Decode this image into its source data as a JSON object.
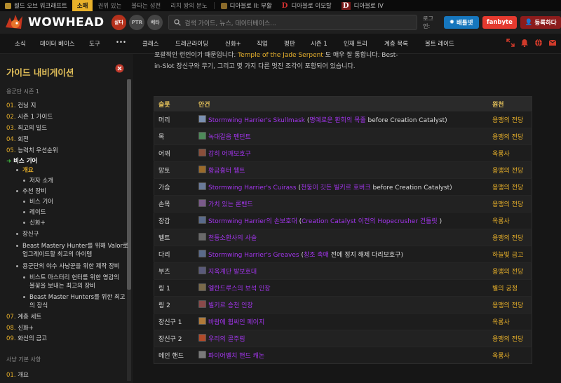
{
  "topbar": {
    "items": [
      {
        "label": "월드 오브 워크래프트",
        "color": "#b38c2d",
        "style": "normal"
      },
      {
        "label": "소매",
        "color": "",
        "style": "active"
      },
      {
        "label": "권위 있는",
        "color": "",
        "style": "dim"
      },
      {
        "label": "불타는 성전",
        "color": "",
        "style": "dim"
      },
      {
        "label": "리치 왕의 분노",
        "color": "",
        "style": "dim"
      }
    ],
    "diablo": [
      "디아블로 II: 부활",
      "디아블로 이모탈",
      "디아블로 IV"
    ]
  },
  "header": {
    "logo_text": "WOWHEAD",
    "pills": [
      "살다",
      "PTR",
      "베타"
    ],
    "search_placeholder": "검색 가이드, 뉴스, 데이터베이스...",
    "login_label": "로그인:",
    "buttons": [
      "배틀넷",
      "fanbyte",
      "등록하다"
    ]
  },
  "nav": {
    "items": [
      "소식",
      "데이터 베이스",
      "도구",
      "•••",
      "클래스",
      "드레곤라이딩",
      "신화+",
      "직업",
      "평판",
      "시즌 1",
      "인재 트리",
      "계층 목록",
      "볼트 레이드"
    ]
  },
  "sidebar": {
    "title": "가이드 내비게이션",
    "section1": "용군단 시즌 1",
    "items": [
      {
        "num": "01.",
        "label": "컨닝 지",
        "type": "num"
      },
      {
        "num": "02.",
        "label": "시즌 1 가이드",
        "type": "num"
      },
      {
        "num": "03.",
        "label": "최고의 빌드",
        "type": "num"
      },
      {
        "num": "04.",
        "label": "회전",
        "type": "num"
      },
      {
        "num": "05.",
        "label": "능력치 우선순위",
        "type": "num"
      },
      {
        "num": "",
        "label": "비스 기어",
        "type": "current"
      },
      {
        "num": "",
        "label": "개요",
        "type": "sub-current"
      },
      {
        "num": "",
        "label": "저자 소개",
        "type": "sub2"
      },
      {
        "num": "",
        "label": "추천 장비",
        "type": "sub"
      },
      {
        "num": "",
        "label": "비스 기어",
        "type": "sub2"
      },
      {
        "num": "",
        "label": "레이드",
        "type": "sub2"
      },
      {
        "num": "",
        "label": "신화+",
        "type": "sub2"
      },
      {
        "num": "",
        "label": "장신구",
        "type": "sub"
      },
      {
        "num": "",
        "label": "Beast Mastery Hunter를 위해 Valor로",
        "type": "sub"
      },
      {
        "num": "",
        "label": "업그레이드할 최고의 아이템",
        "type": "cont"
      },
      {
        "num": "",
        "label": "용군단의 야수 사냥꾼을 위한 제작 장비",
        "type": "sub"
      },
      {
        "num": "",
        "label": "비스트 마스터리 헌터를 위한 영감의",
        "type": "sub2"
      },
      {
        "num": "",
        "label": "불꽃을 보내는 최고의 장비",
        "type": "cont2"
      },
      {
        "num": "",
        "label": "Beast Master Hunters를 위한 최고",
        "type": "sub2"
      },
      {
        "num": "",
        "label": "의 장식",
        "type": "cont2"
      },
      {
        "num": "07.",
        "label": "계층 세트",
        "type": "num"
      },
      {
        "num": "08.",
        "label": "신화+",
        "type": "num"
      },
      {
        "num": "09.",
        "label": "화신의 금고",
        "type": "num"
      }
    ],
    "section2": "사냥 기본 사항",
    "items2": [
      {
        "num": "01.",
        "label": "개요"
      }
    ]
  },
  "content": {
    "intro_line1_a": "포괄적인 런인이기 때문입니다.",
    "intro_line1_link": "Temple of the Jade Serpent",
    "intro_line1_b": "도 매우 잘 통합니다. Best-",
    "intro_line2": "in-Slot 장신구와 무기, 그리고 몇 가지 다른 멋진 조각이 포함되어 있습니다."
  },
  "table": {
    "headers": [
      "슬롯",
      "안건",
      "원천"
    ],
    "rows": [
      {
        "slot": "머리",
        "icon": "#7a8fb0",
        "parts": [
          {
            "t": "Stormwing Harrier's Skullmask",
            "c": "ep"
          },
          {
            "t": " (",
            "c": "item"
          },
          {
            "t": "명예로운 환희의 목줄",
            "c": "ep"
          },
          {
            "t": " before Creation Catalyst)",
            "c": "item"
          }
        ],
        "source": "용맹의 전당"
      },
      {
        "slot": "목",
        "icon": "#4e8a5a",
        "parts": [
          {
            "t": "녹대갈음 펜던트",
            "c": "ep"
          }
        ],
        "source": "용맹의 전당"
      },
      {
        "slot": "어깨",
        "icon": "#8a4e3a",
        "parts": [
          {
            "t": "감히 어깨보호구",
            "c": "ep"
          }
        ],
        "source": "옥룡사"
      },
      {
        "slot": "망토",
        "icon": "#9a6a2a",
        "parts": [
          {
            "t": "황금흉터 웹트",
            "c": "ep"
          }
        ],
        "source": "용맹의 전당"
      },
      {
        "slot": "가슴",
        "icon": "#6a7a9a",
        "parts": [
          {
            "t": "Stormwing Harrier's Cuirass",
            "c": "ep"
          },
          {
            "t": " (",
            "c": "item"
          },
          {
            "t": "천둥이 깃든 빌키르 호버크",
            "c": "ep"
          },
          {
            "t": " before Creation Catalyst)",
            "c": "item"
          }
        ],
        "source": "용맹의 전당"
      },
      {
        "slot": "손목",
        "icon": "#7a5a8a",
        "parts": [
          {
            "t": "가치 있는 론밴드",
            "c": "ep"
          }
        ],
        "source": "용맹의 전당"
      },
      {
        "slot": "장갑",
        "icon": "#5a6a8a",
        "parts": [
          {
            "t": "Stormwing Harrier의 손보호대",
            "c": "ep"
          },
          {
            "t": " (",
            "c": "item"
          },
          {
            "t": "Creation Catalyst 이전의 Hopecrusher 건틀릿",
            "c": "ep"
          },
          {
            "t": " )",
            "c": "item"
          }
        ],
        "source": "옥룡사"
      },
      {
        "slot": "벨트",
        "icon": "#6a6a6a",
        "parts": [
          {
            "t": "천둥소환사의 사슬",
            "c": "ep"
          }
        ],
        "source": "용맹의 전당"
      },
      {
        "slot": "다리",
        "icon": "#5a6a8a",
        "parts": [
          {
            "t": "Stormwing Harrier's Greaves",
            "c": "ep"
          },
          {
            "t": " (",
            "c": "item"
          },
          {
            "t": "창조 촉매",
            "c": "ep"
          },
          {
            "t": " 전에 정지 해제 다리보호구)",
            "c": "item"
          }
        ],
        "source": "하늘빛 금고"
      },
      {
        "slot": "부츠",
        "icon": "#5a5a7a",
        "parts": [
          {
            "t": "지옥계단 발보호대",
            "c": "ep"
          }
        ],
        "source": "용맹의 전당"
      },
      {
        "slot": "링 1",
        "icon": "#7a6a4a",
        "parts": [
          {
            "t": "엘란드루스의 보석 인장",
            "c": "ep"
          }
        ],
        "source": "별의 궁정"
      },
      {
        "slot": "링 2",
        "icon": "#8a4a4a",
        "parts": [
          {
            "t": "빌키르 승천 인장",
            "c": "ep"
          }
        ],
        "source": "용맹의 전당"
      },
      {
        "slot": "장신구 1",
        "icon": "#b07a3a",
        "parts": [
          {
            "t": "바람에 휩싸인 페이지",
            "c": "ep"
          }
        ],
        "source": "옥룡사"
      },
      {
        "slot": "장신구 2",
        "icon": "#b04a2a",
        "parts": [
          {
            "t": "우리의 골주림",
            "c": "ep"
          }
        ],
        "source": "용맹의 전당"
      },
      {
        "slot": "메인 핸드",
        "icon": "#7a7a7a",
        "parts": [
          {
            "t": "파이어벨치 핸드 캐논",
            "c": "ep"
          }
        ],
        "source": "옥룡사"
      }
    ]
  }
}
